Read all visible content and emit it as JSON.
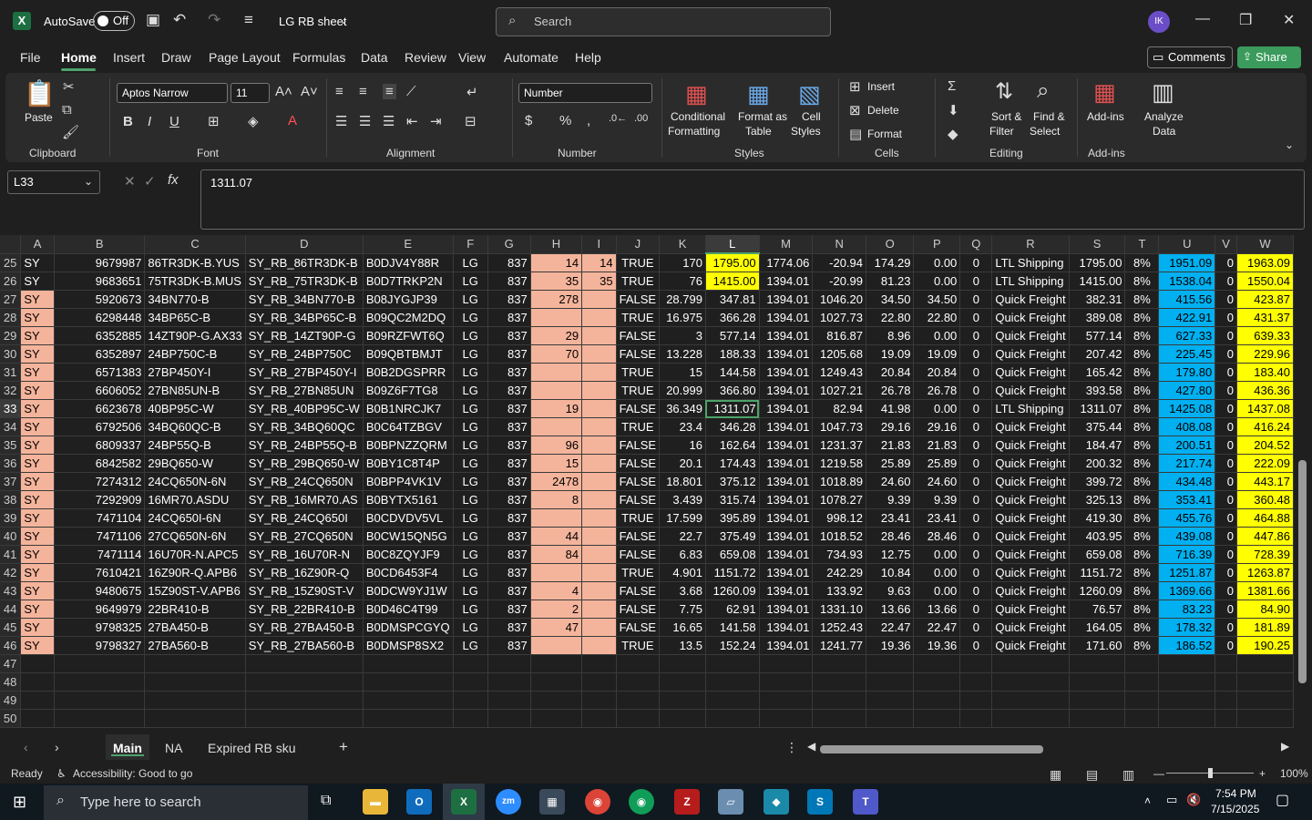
{
  "titlebar": {
    "autosave": "AutoSave",
    "toggle": "Off",
    "doc_title": "LG RB sheet",
    "search_placeholder": "Search",
    "avatar": "IK"
  },
  "menu": [
    "File",
    "Home",
    "Insert",
    "Draw",
    "Page Layout",
    "Formulas",
    "Data",
    "Review",
    "View",
    "Automate",
    "Help"
  ],
  "buttons": {
    "comments": "Comments",
    "share": "Share"
  },
  "ribbon": {
    "paste": "Paste",
    "font_name": "Aptos Narrow",
    "font_size": "11",
    "number_format": "Number",
    "conditional": "Conditional",
    "formatting": "Formatting",
    "format_as": "Format as",
    "table": "Table",
    "cell": "Cell",
    "styles": "Styles",
    "insert": "Insert",
    "delete": "Delete",
    "format": "Format",
    "sort": "Sort &",
    "filter": "Filter",
    "find": "Find &",
    "select": "Select",
    "addins": "Add-ins",
    "analyze": "Analyze",
    "data": "Data",
    "groups": {
      "clipboard": "Clipboard",
      "font": "Font",
      "alignment": "Alignment",
      "number": "Number",
      "styles": "Styles",
      "cells": "Cells",
      "editing": "Editing",
      "addins": "Add-ins"
    }
  },
  "formula_bar": {
    "name_box": "L33",
    "formula": "1311.07"
  },
  "columns": [
    "A",
    "B",
    "C",
    "D",
    "E",
    "F",
    "G",
    "H",
    "I",
    "J",
    "K",
    "L",
    "M",
    "N",
    "O",
    "P",
    "Q",
    "R",
    "S",
    "T",
    "U",
    "V",
    "W"
  ],
  "rows": [
    {
      "n": "25",
      "c": [
        "SY",
        "9679987",
        "86TR3DK-B.YUS",
        "SY_RB_86TR3DK-B",
        "B0DJV4Y88R",
        "LG",
        "837",
        "14",
        "14",
        "TRUE",
        "170",
        "1795.00",
        "1774.06",
        "-20.94",
        "174.29",
        "0.00",
        "0",
        "LTL Shipping",
        "1795.00",
        "8%",
        "1951.09",
        "0",
        "1963.09"
      ]
    },
    {
      "n": "26",
      "c": [
        "SY",
        "9683651",
        "75TR3DK-B.MUS",
        "SY_RB_75TR3DK-B",
        "B0D7TRKP2N",
        "LG",
        "837",
        "35",
        "35",
        "TRUE",
        "76",
        "1415.00",
        "1394.01",
        "-20.99",
        "81.23",
        "0.00",
        "0",
        "LTL Shipping",
        "1415.00",
        "8%",
        "1538.04",
        "0",
        "1550.04"
      ]
    },
    {
      "n": "27",
      "c": [
        "SY",
        "5920673",
        "34BN770-B",
        "SY_RB_34BN770-B",
        "B08JYGJP39",
        "LG",
        "837",
        "278",
        "",
        "FALSE",
        "28.799",
        "347.81",
        "1394.01",
        "1046.20",
        "34.50",
        "34.50",
        "0",
        "Quick Freight",
        "382.31",
        "8%",
        "415.56",
        "0",
        "423.87"
      ]
    },
    {
      "n": "28",
      "c": [
        "SY",
        "6298448",
        "34BP65C-B",
        "SY_RB_34BP65C-B",
        "B09QC2M2DQ",
        "LG",
        "837",
        "",
        "",
        "TRUE",
        "16.975",
        "366.28",
        "1394.01",
        "1027.73",
        "22.80",
        "22.80",
        "0",
        "Quick Freight",
        "389.08",
        "8%",
        "422.91",
        "0",
        "431.37"
      ]
    },
    {
      "n": "29",
      "c": [
        "SY",
        "6352885",
        "14ZT90P-G.AX33",
        "SY_RB_14ZT90P-G",
        "B09RZFWT6Q",
        "LG",
        "837",
        "29",
        "",
        "FALSE",
        "3",
        "577.14",
        "1394.01",
        "816.87",
        "8.96",
        "0.00",
        "0",
        "Quick Freight",
        "577.14",
        "8%",
        "627.33",
        "0",
        "639.33"
      ]
    },
    {
      "n": "30",
      "c": [
        "SY",
        "6352897",
        "24BP750C-B",
        "SY_RB_24BP750C",
        "B09QBTBMJT",
        "LG",
        "837",
        "70",
        "",
        "FALSE",
        "13.228",
        "188.33",
        "1394.01",
        "1205.68",
        "19.09",
        "19.09",
        "0",
        "Quick Freight",
        "207.42",
        "8%",
        "225.45",
        "0",
        "229.96"
      ]
    },
    {
      "n": "31",
      "c": [
        "SY",
        "6571383",
        "27BP450Y-I",
        "SY_RB_27BP450Y-I",
        "B0B2DGSPRR",
        "LG",
        "837",
        "",
        "",
        "TRUE",
        "15",
        "144.58",
        "1394.01",
        "1249.43",
        "20.84",
        "20.84",
        "0",
        "Quick Freight",
        "165.42",
        "8%",
        "179.80",
        "0",
        "183.40"
      ]
    },
    {
      "n": "32",
      "c": [
        "SY",
        "6606052",
        "27BN85UN-B",
        "SY_RB_27BN85UN",
        "B09Z6F7TG8",
        "LG",
        "837",
        "",
        "",
        "TRUE",
        "20.999",
        "366.80",
        "1394.01",
        "1027.21",
        "26.78",
        "26.78",
        "0",
        "Quick Freight",
        "393.58",
        "8%",
        "427.80",
        "0",
        "436.36"
      ]
    },
    {
      "n": "33",
      "c": [
        "SY",
        "6623678",
        "40BP95C-W",
        "SY_RB_40BP95C-W",
        "B0B1NRCJK7",
        "LG",
        "837",
        "19",
        "",
        "FALSE",
        "36.349",
        "1311.07",
        "1394.01",
        "82.94",
        "41.98",
        "0.00",
        "0",
        "LTL Shipping",
        "1311.07",
        "8%",
        "1425.08",
        "0",
        "1437.08"
      ]
    },
    {
      "n": "34",
      "c": [
        "SY",
        "6792506",
        "34BQ60QC-B",
        "SY_RB_34BQ60QC",
        "B0C64TZBGV",
        "LG",
        "837",
        "",
        "",
        "TRUE",
        "23.4",
        "346.28",
        "1394.01",
        "1047.73",
        "29.16",
        "29.16",
        "0",
        "Quick Freight",
        "375.44",
        "8%",
        "408.08",
        "0",
        "416.24"
      ]
    },
    {
      "n": "35",
      "c": [
        "SY",
        "6809337",
        "24BP55Q-B",
        "SY_RB_24BP55Q-B",
        "B0BPNZZQRM",
        "LG",
        "837",
        "96",
        "",
        "FALSE",
        "16",
        "162.64",
        "1394.01",
        "1231.37",
        "21.83",
        "21.83",
        "0",
        "Quick Freight",
        "184.47",
        "8%",
        "200.51",
        "0",
        "204.52"
      ]
    },
    {
      "n": "36",
      "c": [
        "SY",
        "6842582",
        "29BQ650-W",
        "SY_RB_29BQ650-W",
        "B0BY1C8T4P",
        "LG",
        "837",
        "15",
        "",
        "FALSE",
        "20.1",
        "174.43",
        "1394.01",
        "1219.58",
        "25.89",
        "25.89",
        "0",
        "Quick Freight",
        "200.32",
        "8%",
        "217.74",
        "0",
        "222.09"
      ]
    },
    {
      "n": "37",
      "c": [
        "SY",
        "7274312",
        "24CQ650N-6N",
        "SY_RB_24CQ650N",
        "B0BPP4VK1V",
        "LG",
        "837",
        "2478",
        "",
        "FALSE",
        "18.801",
        "375.12",
        "1394.01",
        "1018.89",
        "24.60",
        "24.60",
        "0",
        "Quick Freight",
        "399.72",
        "8%",
        "434.48",
        "0",
        "443.17"
      ]
    },
    {
      "n": "38",
      "c": [
        "SY",
        "7292909",
        "16MR70.ASDU",
        "SY_RB_16MR70.AS",
        "B0BYTX5161",
        "LG",
        "837",
        "8",
        "",
        "FALSE",
        "3.439",
        "315.74",
        "1394.01",
        "1078.27",
        "9.39",
        "9.39",
        "0",
        "Quick Freight",
        "325.13",
        "8%",
        "353.41",
        "0",
        "360.48"
      ]
    },
    {
      "n": "39",
      "c": [
        "SY",
        "7471104",
        "24CQ650I-6N",
        "SY_RB_24CQ650I",
        "B0CDVDV5VL",
        "LG",
        "837",
        "",
        "",
        "TRUE",
        "17.599",
        "395.89",
        "1394.01",
        "998.12",
        "23.41",
        "23.41",
        "0",
        "Quick Freight",
        "419.30",
        "8%",
        "455.76",
        "0",
        "464.88"
      ]
    },
    {
      "n": "40",
      "c": [
        "SY",
        "7471106",
        "27CQ650N-6N",
        "SY_RB_27CQ650N",
        "B0CW15QN5G",
        "LG",
        "837",
        "44",
        "",
        "FALSE",
        "22.7",
        "375.49",
        "1394.01",
        "1018.52",
        "28.46",
        "28.46",
        "0",
        "Quick Freight",
        "403.95",
        "8%",
        "439.08",
        "0",
        "447.86"
      ]
    },
    {
      "n": "41",
      "c": [
        "SY",
        "7471114",
        "16U70R-N.APC5",
        "SY_RB_16U70R-N",
        "B0C8ZQYJF9",
        "LG",
        "837",
        "84",
        "",
        "FALSE",
        "6.83",
        "659.08",
        "1394.01",
        "734.93",
        "12.75",
        "0.00",
        "0",
        "Quick Freight",
        "659.08",
        "8%",
        "716.39",
        "0",
        "728.39"
      ]
    },
    {
      "n": "42",
      "c": [
        "SY",
        "7610421",
        "16Z90R-Q.APB6",
        "SY_RB_16Z90R-Q",
        "B0CD6453F4",
        "LG",
        "837",
        "",
        "",
        "TRUE",
        "4.901",
        "1151.72",
        "1394.01",
        "242.29",
        "10.84",
        "0.00",
        "0",
        "Quick Freight",
        "1151.72",
        "8%",
        "1251.87",
        "0",
        "1263.87"
      ]
    },
    {
      "n": "43",
      "c": [
        "SY",
        "9480675",
        "15Z90ST-V.APB6",
        "SY_RB_15Z90ST-V",
        "B0DCW9YJ1W",
        "LG",
        "837",
        "4",
        "",
        "FALSE",
        "3.68",
        "1260.09",
        "1394.01",
        "133.92",
        "9.63",
        "0.00",
        "0",
        "Quick Freight",
        "1260.09",
        "8%",
        "1369.66",
        "0",
        "1381.66"
      ]
    },
    {
      "n": "44",
      "c": [
        "SY",
        "9649979",
        "22BR410-B",
        "SY_RB_22BR410-B",
        "B0D46C4T99",
        "LG",
        "837",
        "2",
        "",
        "FALSE",
        "7.75",
        "62.91",
        "1394.01",
        "1331.10",
        "13.66",
        "13.66",
        "0",
        "Quick Freight",
        "76.57",
        "8%",
        "83.23",
        "0",
        "84.90"
      ]
    },
    {
      "n": "45",
      "c": [
        "SY",
        "9798325",
        "27BA450-B",
        "SY_RB_27BA450-B",
        "B0DMSPCGYQ",
        "LG",
        "837",
        "47",
        "",
        "FALSE",
        "16.65",
        "141.58",
        "1394.01",
        "1252.43",
        "22.47",
        "22.47",
        "0",
        "Quick Freight",
        "164.05",
        "8%",
        "178.32",
        "0",
        "181.89"
      ]
    },
    {
      "n": "46",
      "c": [
        "SY",
        "9798327",
        "27BA560-B",
        "SY_RB_27BA560-B",
        "B0DMSP8SX2",
        "LG",
        "837",
        "",
        "",
        "TRUE",
        "13.5",
        "152.24",
        "1394.01",
        "1241.77",
        "19.36",
        "19.36",
        "0",
        "Quick Freight",
        "171.60",
        "8%",
        "186.52",
        "0",
        "190.25"
      ]
    }
  ],
  "empty_rows": [
    "47",
    "48",
    "49",
    "50"
  ],
  "sheet_tabs": [
    "Main",
    "NA",
    "Expired RB sku"
  ],
  "status": {
    "ready": "Ready",
    "accessibility": "Accessibility: Good to go",
    "zoom": "100%"
  },
  "taskbar": {
    "search_placeholder": "Type here to search",
    "time": "7:54 PM",
    "date": "7/15/2025"
  },
  "colors": {
    "salmon": "#f4b49b",
    "yellow": "#ffff00",
    "blue": "#00b0f0",
    "accent": "#4ea36b"
  }
}
